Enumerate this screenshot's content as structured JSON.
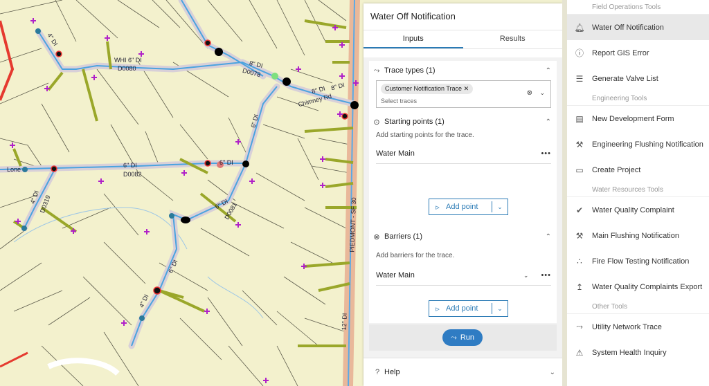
{
  "map": {
    "labels": [
      "4\" DI",
      "WHI 6\" DI",
      "D0080",
      "8\" DI",
      "D0078",
      "8\" DI",
      "6\" DI",
      "6\" DI",
      "D0082",
      "6\" DI",
      "4\" DI",
      "D0319",
      "6\" DI",
      "D0081",
      "6\" DI",
      "4\" DI",
      "12\" DI",
      "8\" DI",
      "Chimney Rd",
      "Lone",
      "PIEDMONT - SF 30"
    ]
  },
  "panel": {
    "title": "Water Off Notification",
    "tabs": [
      "Inputs",
      "Results"
    ],
    "trace_types": {
      "header": "Trace types (1)",
      "chip": "Customer Notification Trace",
      "placeholder": "Select traces"
    },
    "starting_points": {
      "header": "Starting points (1)",
      "hint": "Add starting points for the trace.",
      "item": "Water Main",
      "add_label": "Add point"
    },
    "barriers": {
      "header": "Barriers (1)",
      "hint": "Add barriers for the trace.",
      "item": "Water Main",
      "add_label": "Add point"
    },
    "run_label": "Run",
    "help_label": "Help"
  },
  "tools": {
    "group1": "Field Operations Tools",
    "water_off": "Water Off Notification",
    "report_gis": "Report GIS Error",
    "valve_list": "Generate Valve List",
    "group2": "Engineering Tools",
    "new_dev": "New Development Form",
    "eng_flush": "Engineering Flushing Notification",
    "create_project": "Create Project",
    "group3": "Water Resources Tools",
    "wq_complaint": "Water Quality Complaint",
    "main_flush": "Main Flushing Notification",
    "fire_flow": "Fire Flow Testing Notification",
    "wq_export": "Water Quality Complaints Export",
    "group4": "Other Tools",
    "un_trace": "Utility Network Trace",
    "health": "System Health Inquiry"
  },
  "colors": {
    "accent": "#2a7ab5",
    "main_line": "#5aa9e6",
    "service_line": "#9aa72a",
    "parcel_bg": "#f3f1cd"
  }
}
